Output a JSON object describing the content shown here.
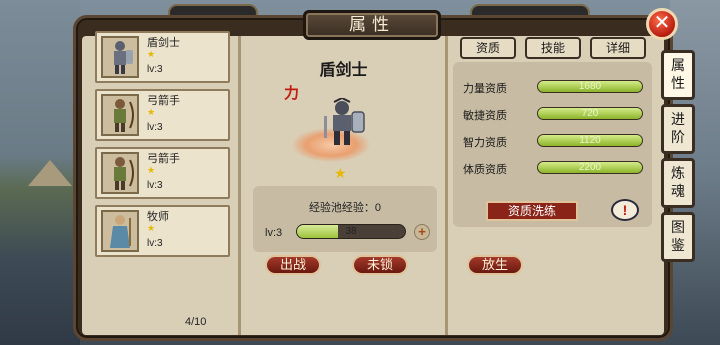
{
  "window": {
    "title": "属性",
    "close_label": "✕"
  },
  "hero_list": {
    "items": [
      {
        "name": "盾剑士",
        "level": "lv:3"
      },
      {
        "name": "弓箭手",
        "level": "lv:3"
      },
      {
        "name": "弓箭手",
        "level": "lv:3"
      },
      {
        "name": "牧师",
        "level": "lv:3"
      }
    ],
    "page_count": "4/10"
  },
  "hero_detail": {
    "name": "盾剑士",
    "class_icon_text": "力",
    "exp_pool_label": "经验池经验：0",
    "level": "lv:3",
    "exp_value": "38",
    "exp_fraction": 0.38,
    "buttons": {
      "deploy": "出战",
      "lock": "未锁",
      "release": "放生"
    }
  },
  "tabs": {
    "aptitude": "资质",
    "skills": "技能",
    "details": "详细"
  },
  "stats": [
    {
      "label": "力量资质",
      "value": "1680",
      "fraction": 1.0
    },
    {
      "label": "敏捷资质",
      "value": "720",
      "fraction": 1.0
    },
    {
      "label": "智力资质",
      "value": "1120",
      "fraction": 1.0
    },
    {
      "label": "体质资质",
      "value": "2200",
      "fraction": 1.0
    }
  ],
  "wash_button_label": "资质洗练",
  "info_button_label": "!",
  "side_tabs": [
    {
      "label": "属性"
    },
    {
      "label": "进阶"
    },
    {
      "label": "炼魂"
    },
    {
      "label": "图鉴"
    }
  ],
  "colors": {
    "accent_red": "#8a2418",
    "bar_green": "#9cc33a",
    "panel_bg": "#d9cfb7"
  }
}
